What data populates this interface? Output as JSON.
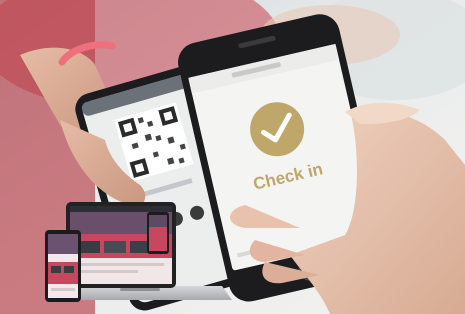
{
  "photo": {
    "check_in_label": "Check in",
    "colors": {
      "brand_gold": "#BFA76A",
      "pink_accent": "#C7485E",
      "phone_black": "#1C1C1E",
      "screen_white": "#F4F4F2"
    }
  }
}
